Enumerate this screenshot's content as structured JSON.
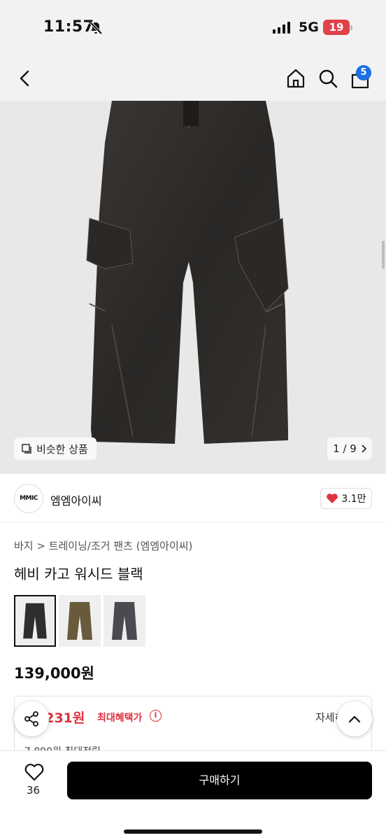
{
  "status": {
    "time": "11:57",
    "network": "5G",
    "battery": "19"
  },
  "nav": {
    "cart_count": "5"
  },
  "gallery": {
    "similar_label": "비슷한 상품",
    "pager": "1 / 9"
  },
  "brand": {
    "logo": "MMIC",
    "name": "엠엠아이씨",
    "likes": "3.1만"
  },
  "product": {
    "breadcrumb": "바지 > 트레이닝/조거 팬츠 (엠엠아이씨)",
    "title": "헤비 카고 워시드 블랙",
    "swatches": [
      {
        "color": "#2e2e2e",
        "selected": true
      },
      {
        "color": "#6a5a3c",
        "selected": false
      },
      {
        "color": "#4c4a50",
        "selected": false
      }
    ],
    "price": "139,000원"
  },
  "benefit": {
    "price": ",231원",
    "label": "최대혜택가",
    "detail": "자세히",
    "points": "7,890원 최대적립"
  },
  "bottom": {
    "like_count": "36",
    "buy_label": "구매하기"
  },
  "colors": {
    "accent": "#1c6fe6",
    "sale": "#e0313d",
    "buy": "#000000"
  }
}
